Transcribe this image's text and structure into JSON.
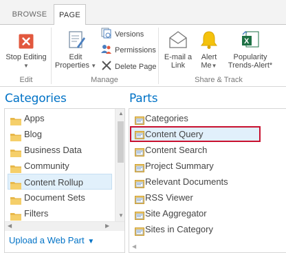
{
  "tabs": [
    {
      "label": "BROWSE",
      "active": false
    },
    {
      "label": "PAGE",
      "active": true
    }
  ],
  "ribbon": {
    "edit_group": {
      "label": "Edit",
      "stop_editing": "Stop Editing"
    },
    "manage_group": {
      "label": "Manage",
      "edit_properties_line1": "Edit",
      "edit_properties_line2": "Properties",
      "versions": "Versions",
      "permissions": "Permissions",
      "delete_page": "Delete Page"
    },
    "share_group": {
      "label": "Share & Track",
      "email_line1": "E-mail a",
      "email_line2": "Link",
      "alert_line1": "Alert",
      "alert_line2": "Me",
      "popularity_line1": "Popularity",
      "popularity_line2": "Trends-Alert*"
    }
  },
  "categories": {
    "title": "Categories",
    "items": [
      "Apps",
      "Blog",
      "Business Data",
      "Community",
      "Content Rollup",
      "Document Sets",
      "Filters"
    ],
    "selected": "Content Rollup",
    "upload_label": "Upload a Web Part"
  },
  "parts": {
    "title": "Parts",
    "items": [
      "Categories",
      "Content Query",
      "Content Search",
      "Project Summary",
      "Relevant Documents",
      "RSS Viewer",
      "Site Aggregator",
      "Sites in Category"
    ],
    "highlighted": "Content Query"
  },
  "colors": {
    "accent": "#0072c6",
    "highlight_border": "#c8102e",
    "selection_bg": "#e1f0fb",
    "stop_editing_red": "#e2583e",
    "alert_yellow": "#f4c20d",
    "excel_green": "#1e7145"
  }
}
